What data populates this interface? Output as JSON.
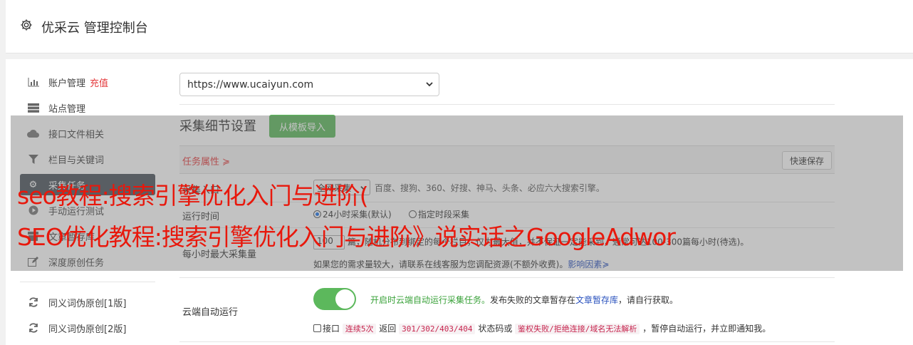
{
  "header": {
    "title": "优采云 管理控制台",
    "icon": "gear-icon"
  },
  "sidebar": {
    "items": [
      {
        "label": "账户管理",
        "accent": "充值",
        "icon": "bar-chart-icon"
      },
      {
        "label": "站点管理",
        "icon": "server-icon"
      },
      {
        "label": "接口文件相关",
        "icon": "cloud-icon"
      },
      {
        "label": "栏目与关键词",
        "icon": "filter-icon"
      },
      {
        "label": "采集任务",
        "icon": "gears-icon"
      },
      {
        "label": "手动运行测试",
        "icon": "play-icon"
      },
      {
        "label": "文章暂存库",
        "icon": "box-icon"
      },
      {
        "label": "深度原创任务",
        "icon": "edit-icon"
      },
      {
        "label": "同义词伪原创[1版]",
        "icon": "refresh-icon"
      },
      {
        "label": "同义词伪原创[2版]",
        "icon": "refresh-icon"
      }
    ]
  },
  "site_select": {
    "value": "https://www.ucaiyun.com"
  },
  "section": {
    "title": "采集细节设置",
    "template_button": "从模板导入"
  },
  "task_bar": {
    "label": "任务属性 ≽",
    "quick_save": "快速保存"
  },
  "rows": {
    "source": {
      "label": "采集入口",
      "select_value": "全网采集",
      "engines": "百度、搜狗、360、好搜、神马、头条、必应六大搜索引擎。"
    },
    "runtime": {
      "label": "运行时间",
      "opt1": "24小时采集(默认)",
      "opt2": "指定时段采集"
    },
    "max": {
      "label": "每小时最大采集量",
      "value": "100",
      "text": "篇，随机分布到绑定的每个栏目，仅为最大值，并不保证一定能采到，通常可达100-300篇每小时(待选)。",
      "hint": "如果您的需求量较大，请联系在线客服为您调配资源(不额外收费)。",
      "link": "影响因素≽"
    },
    "cloud": {
      "label": "云端自动运行",
      "desc_green": "开启时云端自动运行采集任务。",
      "desc_mid": "发布失败的文章暂存在",
      "desc_link": "文章暂存库",
      "desc_end": "，请自行获取。",
      "c1": "接口",
      "code1": "连续5次",
      "t2": "返回",
      "code2": "301/302/403/404",
      "t3": "状态码或",
      "code3": "鉴权失败/拒绝连接/域名无法解析",
      "t4": "，暂停自动运行，并立即通知我。"
    }
  },
  "overlay_text": {
    "line1": "seo教程:搜索引擎优化入门与进阶(",
    "line2": "SEO优化教程:搜索引擎优化入门与进阶》说实话之GoogleAdwor"
  },
  "colors": {
    "accent_red": "#e4393c",
    "green": "#5cb85c",
    "sidebar_active": "#4a535c",
    "overlay_text": "#e8180c"
  }
}
